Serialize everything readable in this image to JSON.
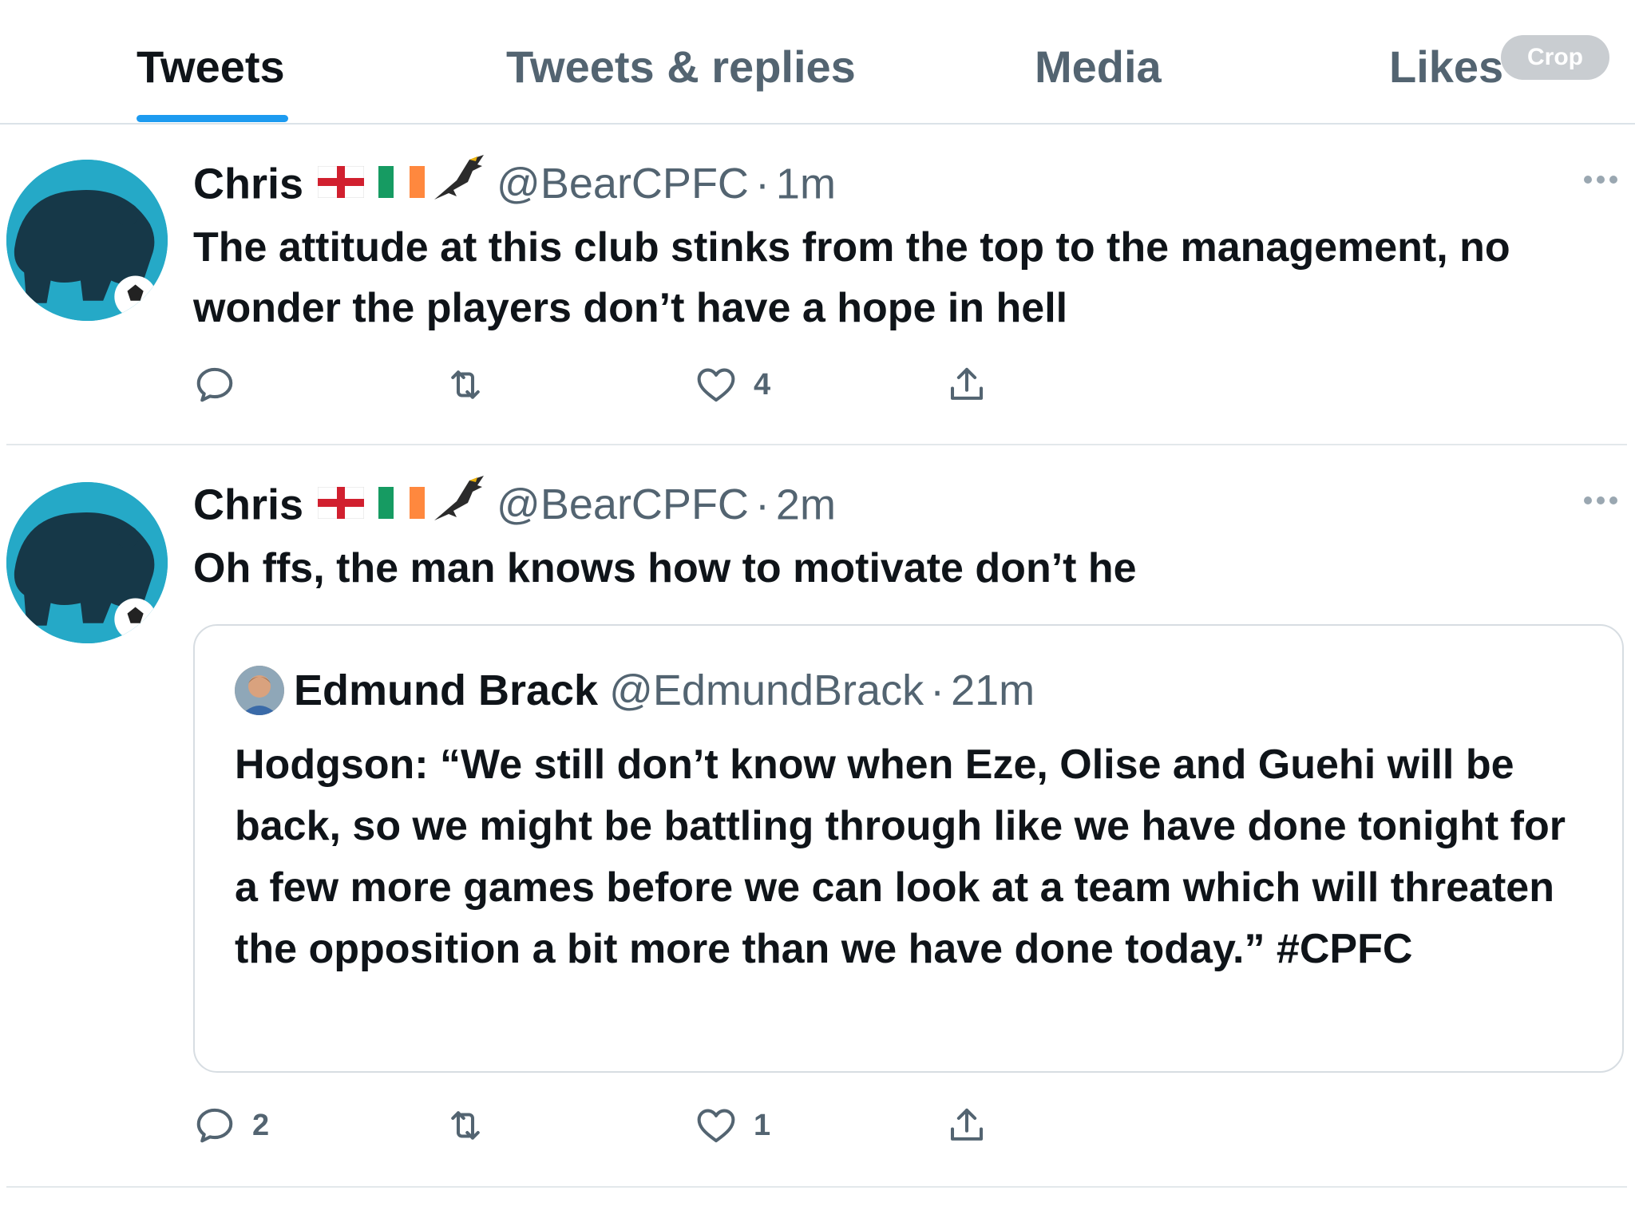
{
  "tabs": [
    {
      "label": "Tweets",
      "active": true
    },
    {
      "label": "Tweets & replies",
      "active": false
    },
    {
      "label": "Media",
      "active": false
    },
    {
      "label": "Likes",
      "active": false
    }
  ],
  "crop_label": "Crop",
  "colors": {
    "accent": "#1d9bf0",
    "muted": "#536471",
    "avatar_bg": "#25a9c7"
  },
  "tweets": [
    {
      "display_name": "Chris",
      "emoji": [
        "flag-england-icon",
        "flag-ireland-icon",
        "eagle-icon"
      ],
      "handle": "@BearCPFC",
      "separator": "·",
      "time": "1m",
      "text": "The attitude at this club stinks from the top to the management, no wonder the players don’t have a hope in hell",
      "actions": {
        "reply_count": "",
        "retweet_count": "",
        "like_count": "4"
      }
    },
    {
      "display_name": "Chris",
      "emoji": [
        "flag-england-icon",
        "flag-ireland-icon",
        "eagle-icon"
      ],
      "handle": "@BearCPFC",
      "separator": "·",
      "time": "2m",
      "text": "Oh ffs, the man knows how to motivate don’t he",
      "quote": {
        "display_name": "Edmund Brack",
        "handle": "@EdmundBrack",
        "separator": "·",
        "time": "21m",
        "text": "Hodgson: “We still don’t know when Eze, Olise and Guehi will be back, so we might be battling through like we have done tonight for a few more games before we can look at a team which will threaten the opposition a bit more than we have done today.” #CPFC"
      },
      "actions": {
        "reply_count": "2",
        "retweet_count": "",
        "like_count": "1"
      }
    }
  ]
}
